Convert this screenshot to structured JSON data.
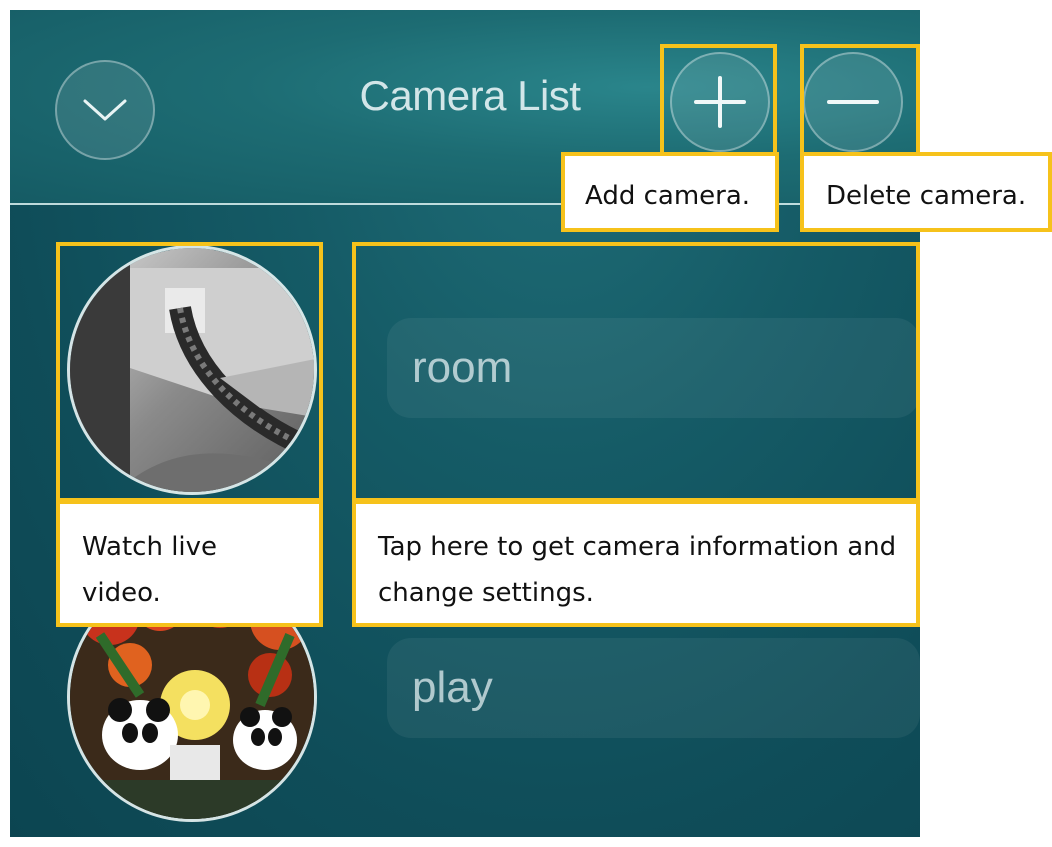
{
  "header": {
    "title": "Camera List",
    "collapse_icon": "chevron-down-icon",
    "add_icon": "plus-icon",
    "delete_icon": "minus-icon"
  },
  "cameras": [
    {
      "name": "room"
    },
    {
      "name": "play"
    }
  ],
  "callouts": {
    "add": "Add camera.",
    "delete": "Delete camera.",
    "live_line1": "Watch live",
    "live_line2": "video.",
    "info_line1": "Tap here to get camera information and",
    "info_line2": "change settings."
  },
  "colors": {
    "highlight": "#f6c21b",
    "background": "#0f4d59",
    "header": "#1d6c73"
  }
}
